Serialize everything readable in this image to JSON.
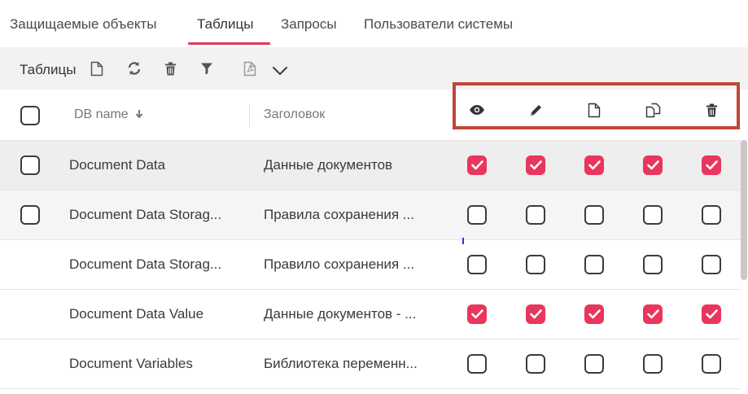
{
  "tabs": [
    {
      "label": "Защищаемые объекты",
      "active": false
    },
    {
      "label": "Таблицы",
      "active": true
    },
    {
      "label": "Запросы",
      "active": false
    },
    {
      "label": "Пользователи системы",
      "active": false
    }
  ],
  "toolbar": {
    "title": "Таблицы",
    "buttons": [
      "new-document-icon",
      "refresh-icon",
      "trash-icon",
      "filter-icon",
      "pdf-icon",
      "chevron-down-icon"
    ]
  },
  "table": {
    "columns": {
      "db_name": "DB name",
      "title": "Заголовок"
    },
    "permission_icons": [
      "eye-icon",
      "pencil-icon",
      "document-icon",
      "copy-icon",
      "trash-icon"
    ],
    "rows": [
      {
        "db_name": "Document Data",
        "title": "Данные документов",
        "perms": [
          true,
          true,
          true,
          true,
          true
        ]
      },
      {
        "db_name": "Document Data Storag...",
        "title": "Правила сохранения ...",
        "perms": [
          false,
          false,
          false,
          false,
          false
        ]
      },
      {
        "db_name": "Document Data Storag...",
        "title": "Правило сохранения ...",
        "perms": [
          false,
          false,
          false,
          false,
          false
        ]
      },
      {
        "db_name": "Document Data Value",
        "title": "Данные документов - ...",
        "perms": [
          true,
          true,
          true,
          true,
          true
        ]
      },
      {
        "db_name": "Document Variables",
        "title": "Библиотека переменн...",
        "perms": [
          false,
          false,
          false,
          false,
          false
        ]
      }
    ]
  },
  "colors": {
    "accent": "#e8365d",
    "highlight_box": "#c0463b",
    "toolbar_bg": "#f2f2f2"
  }
}
